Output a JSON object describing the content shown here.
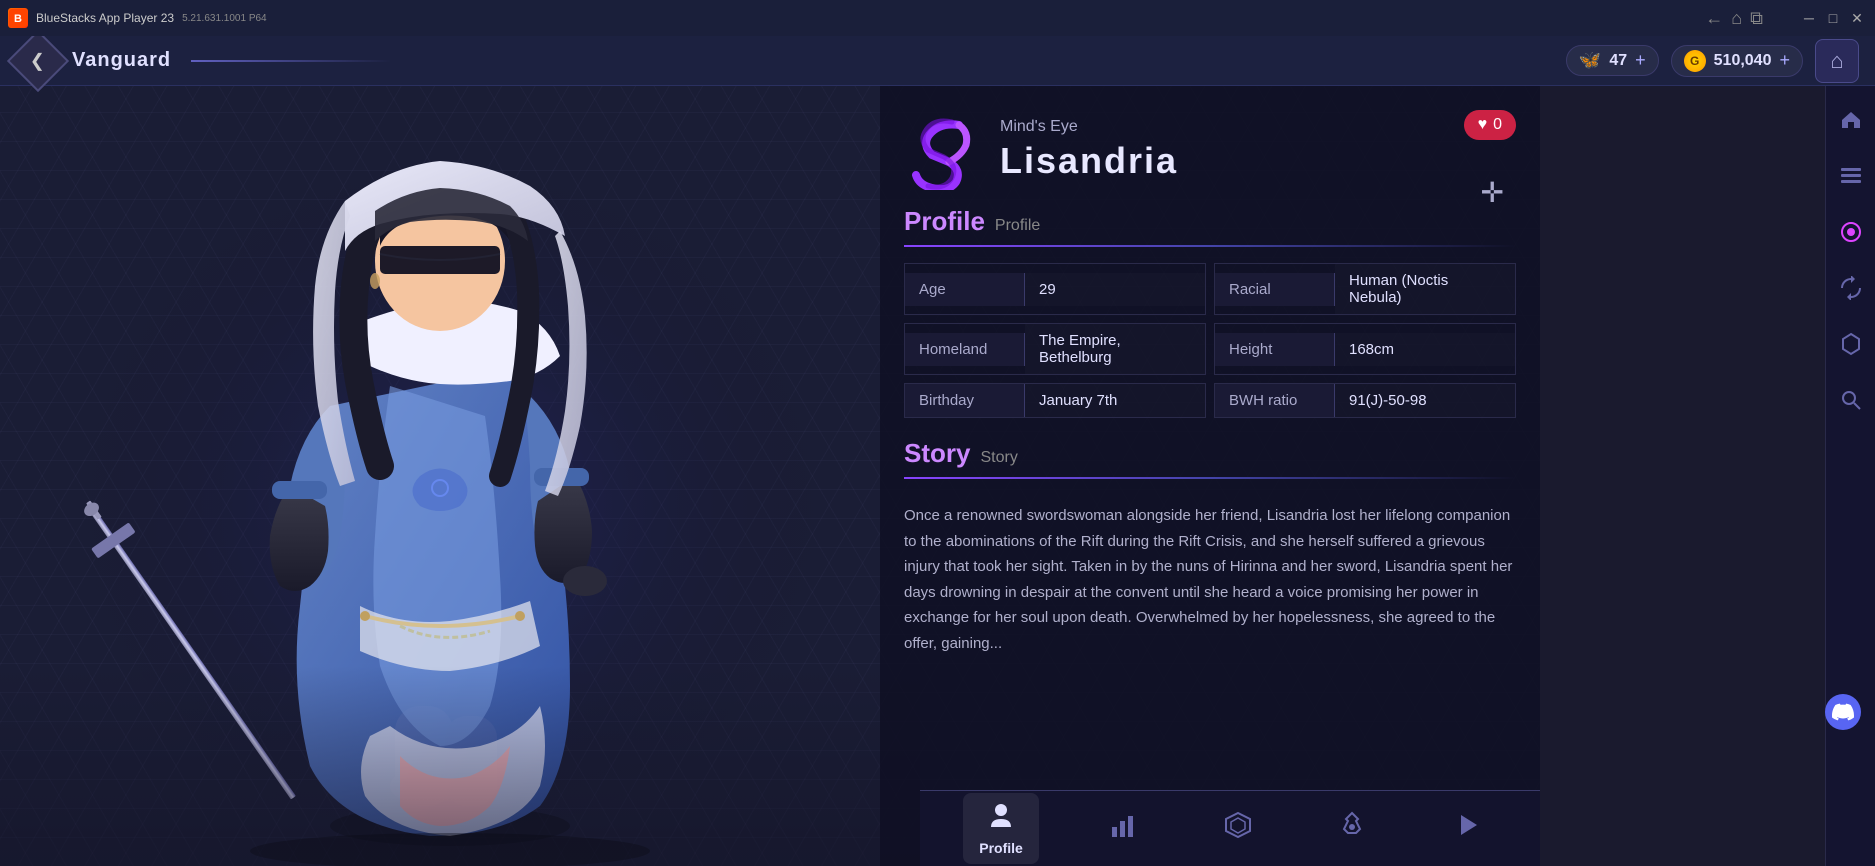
{
  "titlebar": {
    "app_icon": "B",
    "app_name": "BlueStacks App Player 23",
    "app_version": "5.21.631.1001 P64",
    "nav_back": "←",
    "nav_home": "⌂",
    "nav_page": "⧉",
    "win_minimize": "─",
    "win_maximize": "□",
    "win_close": "✕"
  },
  "navbar": {
    "back_btn": "❮",
    "title": "Vanguard",
    "butterfly_count": "47",
    "butterfly_plus": "+",
    "gold_amount": "510,040",
    "gold_plus": "+",
    "home_icon": "⌂"
  },
  "character": {
    "logo_alt": "Mind's Eye logo",
    "subtitle": "Mind's Eye",
    "name": "Lisandria",
    "heart_count": "0",
    "heart_icon": "♥",
    "move_icon": "✛"
  },
  "profile_section": {
    "title_main": "Profile",
    "title_sub": "Profile",
    "stats": [
      {
        "label": "Age",
        "value": "29"
      },
      {
        "label": "Racial",
        "value": "Human (Noctis Nebula)"
      },
      {
        "label": "Homeland",
        "value": "The Empire, Bethelburg"
      },
      {
        "label": "Height",
        "value": "168cm"
      },
      {
        "label": "Birthday",
        "value": "January 7th"
      },
      {
        "label": "BWH ratio",
        "value": "91(J)-50-98"
      }
    ]
  },
  "story_section": {
    "title_main": "Story",
    "title_sub": "Story",
    "text": "Once a renowned swordswoman alongside her friend, Lisandria lost her lifelong companion to the abominations of the Rift during the Rift Crisis, and she herself suffered a grievous injury that took her sight. Taken in by the nuns of Hirinna and her sword, Lisandria spent her days drowning in despair at the convent until she heard a voice promising her power in exchange for her soul upon death. Overwhelmed by her hopelessness, she agreed to the offer, gaining..."
  },
  "bottom_tabs": [
    {
      "icon": "👤",
      "label": "Profile",
      "active": true
    },
    {
      "icon": "📊",
      "label": "",
      "active": false
    },
    {
      "icon": "⬡",
      "label": "",
      "active": false
    },
    {
      "icon": "◈",
      "label": "",
      "active": false
    },
    {
      "icon": "▶",
      "label": "",
      "active": false
    }
  ],
  "right_sidebar": {
    "icons": [
      "⌂",
      "☰",
      "◉",
      "↺",
      "⬡",
      "🔍"
    ]
  }
}
